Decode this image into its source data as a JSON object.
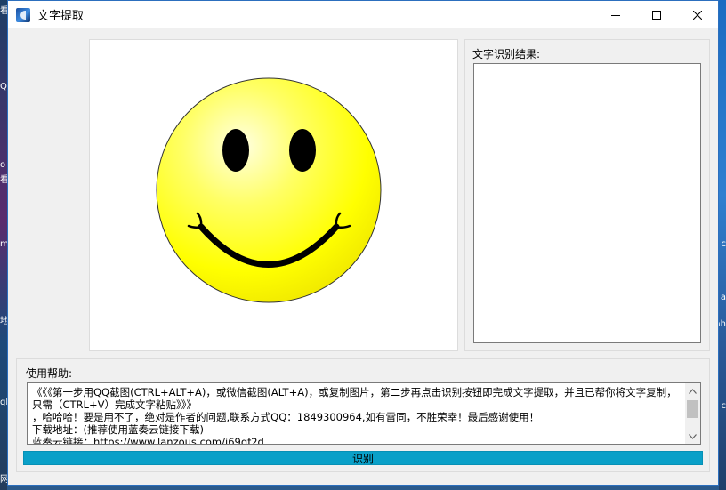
{
  "window": {
    "title": "文字提取",
    "controls": {
      "minimize": "minimize",
      "maximize": "maximize",
      "close": "close"
    }
  },
  "image_panel": {
    "content": "smiley-face",
    "colors": {
      "face": "#ffff00",
      "features": "#000000"
    }
  },
  "result": {
    "label": "文字识别结果:",
    "value": ""
  },
  "help": {
    "label": "使用帮助:",
    "text": "《《《第一步用QQ截图(CTRL+ALT+A)，或微信截图(ALT+A)，或复制图片，第二步再点击识别按钮即完成文字提取，并且已帮你将文字复制，只需（CTRL+V）完成文字粘贴》》》\n，哈哈哈！要是用不了，绝对是作者的问题,联系方式QQ：1849300964,如有雷同，不胜荣幸！最后感谢使用！\n下载地址：(推荐使用蓝奏云链接下载)\n蓝奏云链接：https://www.lanzous.com/i69qf2d"
  },
  "recognize_button": {
    "label": "识别",
    "color": "#0aa0c8"
  },
  "desktop": {
    "left_glyphs": [
      "看",
      "Q",
      "o",
      "看",
      "m",
      "地",
      "gl",
      "网"
    ],
    "right_glyphs": [
      "c",
      "a",
      "ah",
      "c"
    ]
  }
}
